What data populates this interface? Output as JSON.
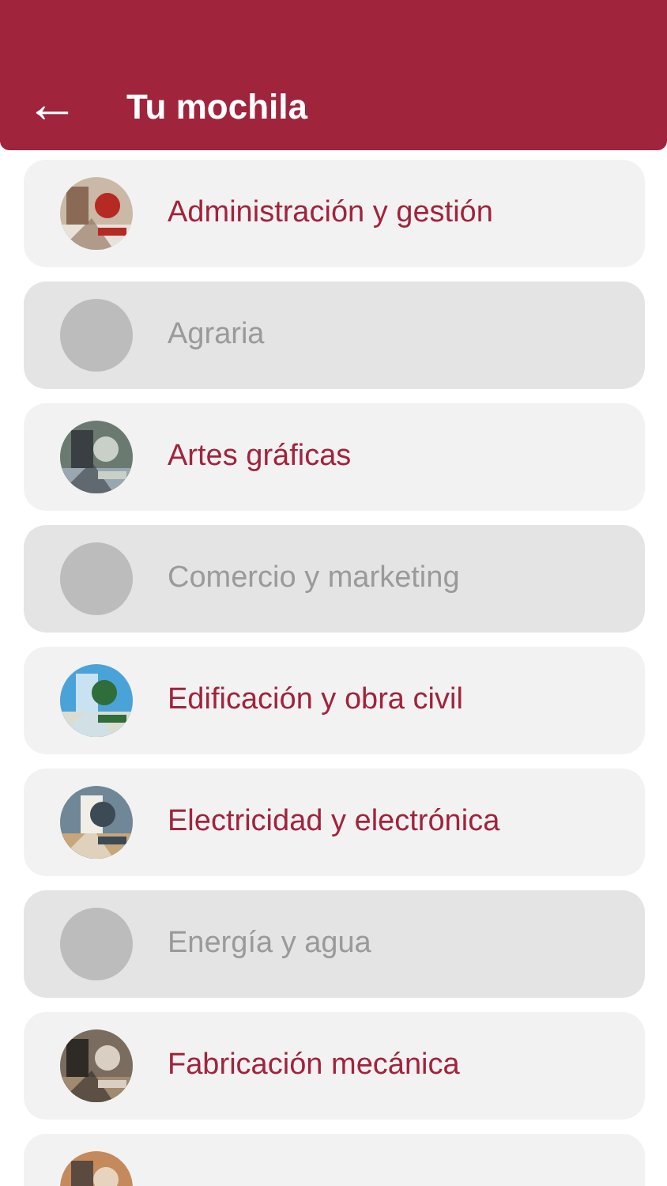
{
  "header": {
    "back": "←",
    "title": "Tu mochila"
  },
  "items": [
    {
      "label": "Administración y gestión",
      "disabled": false
    },
    {
      "label": "Agraria",
      "disabled": true
    },
    {
      "label": "Artes gráficas",
      "disabled": false
    },
    {
      "label": "Comercio y marketing",
      "disabled": true
    },
    {
      "label": "Edificación y obra civil",
      "disabled": false
    },
    {
      "label": "Electricidad y electrónica",
      "disabled": false
    },
    {
      "label": "Energía y agua",
      "disabled": true
    },
    {
      "label": "Fabricación mecánica",
      "disabled": false
    },
    {
      "disabled": false
    }
  ]
}
